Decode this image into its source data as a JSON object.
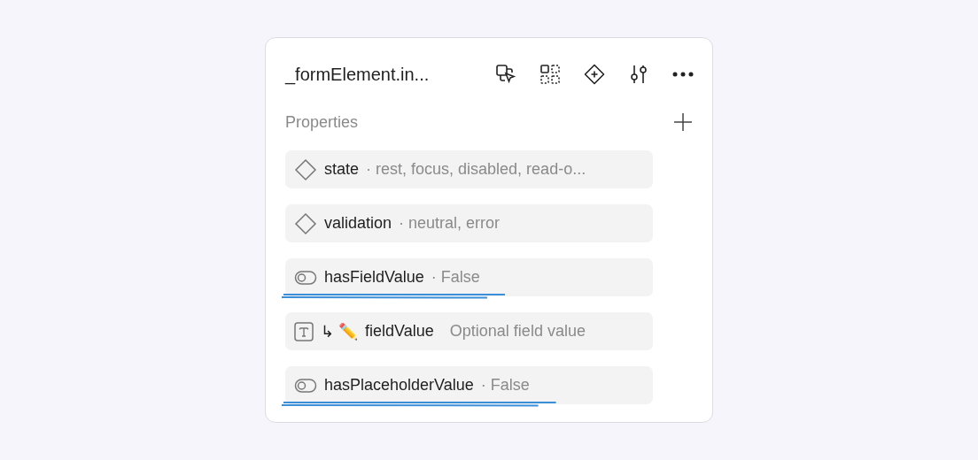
{
  "panel": {
    "title": "_formElement.in...",
    "section": "Properties",
    "properties": [
      {
        "kind": "variant",
        "name": "state",
        "value": "· rest, focus, disabled, read-o...",
        "underlined": false
      },
      {
        "kind": "variant",
        "name": "validation",
        "value": "· neutral, error",
        "underlined": false
      },
      {
        "kind": "boolean",
        "name": "hasFieldValue",
        "value": "· False",
        "underlined": true
      },
      {
        "kind": "text",
        "prefix": "↳ ✏️",
        "name": "fieldValue",
        "value": "Optional field value",
        "underlined": false
      },
      {
        "kind": "boolean",
        "name": "hasPlaceholderValue",
        "value": "· False",
        "underlined": true
      }
    ]
  }
}
